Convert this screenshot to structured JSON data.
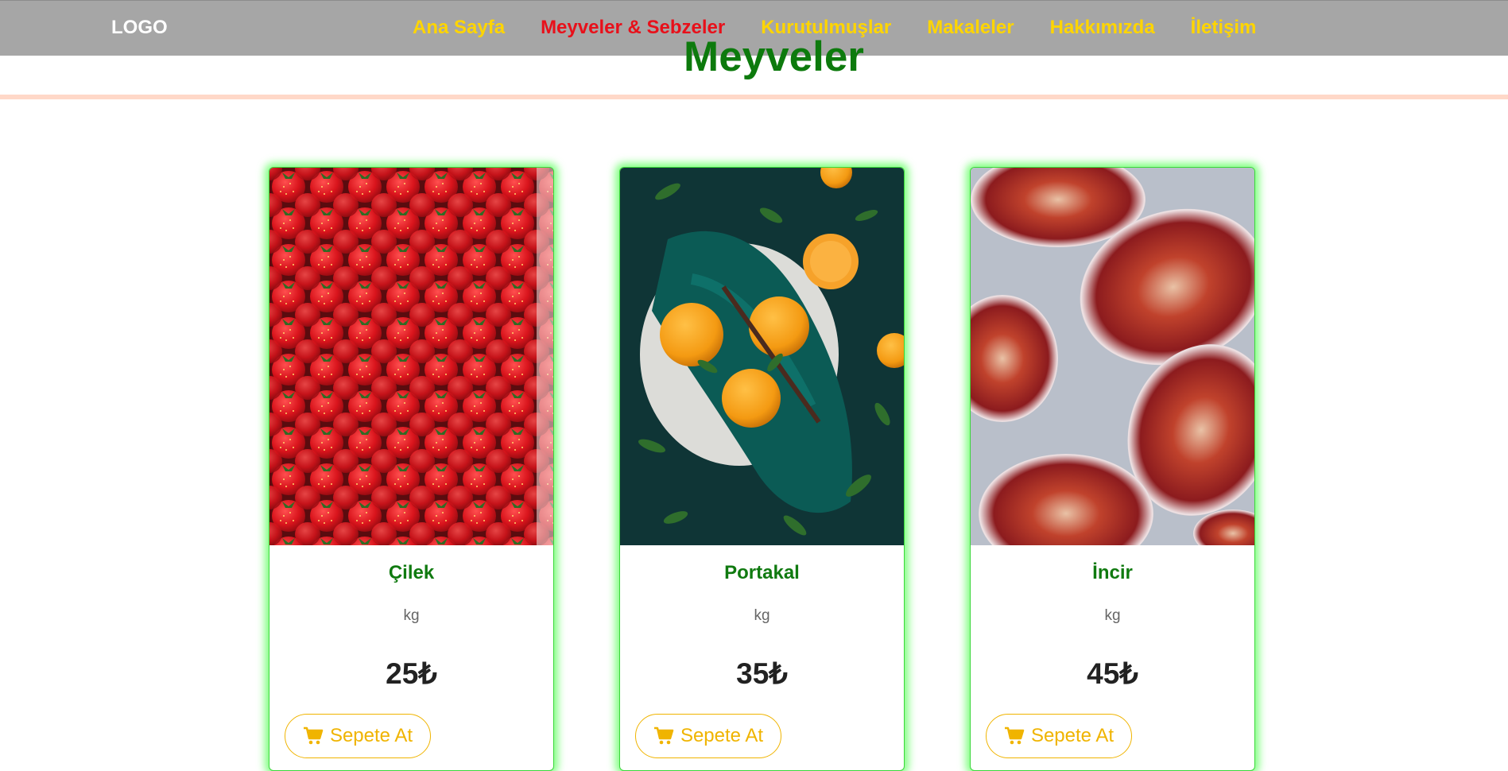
{
  "brand": {
    "logo": "LOGO"
  },
  "nav": {
    "items": [
      {
        "label": "Ana Sayfa",
        "active": false
      },
      {
        "label": "Meyveler & Sebzeler",
        "active": true
      },
      {
        "label": "Kurutulmuşlar",
        "active": false
      },
      {
        "label": "Makaleler",
        "active": false
      },
      {
        "label": "Hakkımızda",
        "active": false
      },
      {
        "label": "İletişim",
        "active": false
      }
    ]
  },
  "page": {
    "title": "Meyveler"
  },
  "products": [
    {
      "name": "Çilek",
      "unit": "kg",
      "price": "25₺",
      "button": "Sepete At",
      "image": "strawberries"
    },
    {
      "name": "Portakal",
      "unit": "kg",
      "price": "35₺",
      "button": "Sepete At",
      "image": "oranges"
    },
    {
      "name": "İncir",
      "unit": "kg",
      "price": "45₺",
      "button": "Sepete At",
      "image": "figs"
    }
  ],
  "colors": {
    "nav_bg": "#a6a6a6",
    "nav_link": "#ffd500",
    "nav_active": "#e8101a",
    "title": "#0d7a0d",
    "card_glow": "#5aff5a",
    "button": "#f0b400"
  }
}
